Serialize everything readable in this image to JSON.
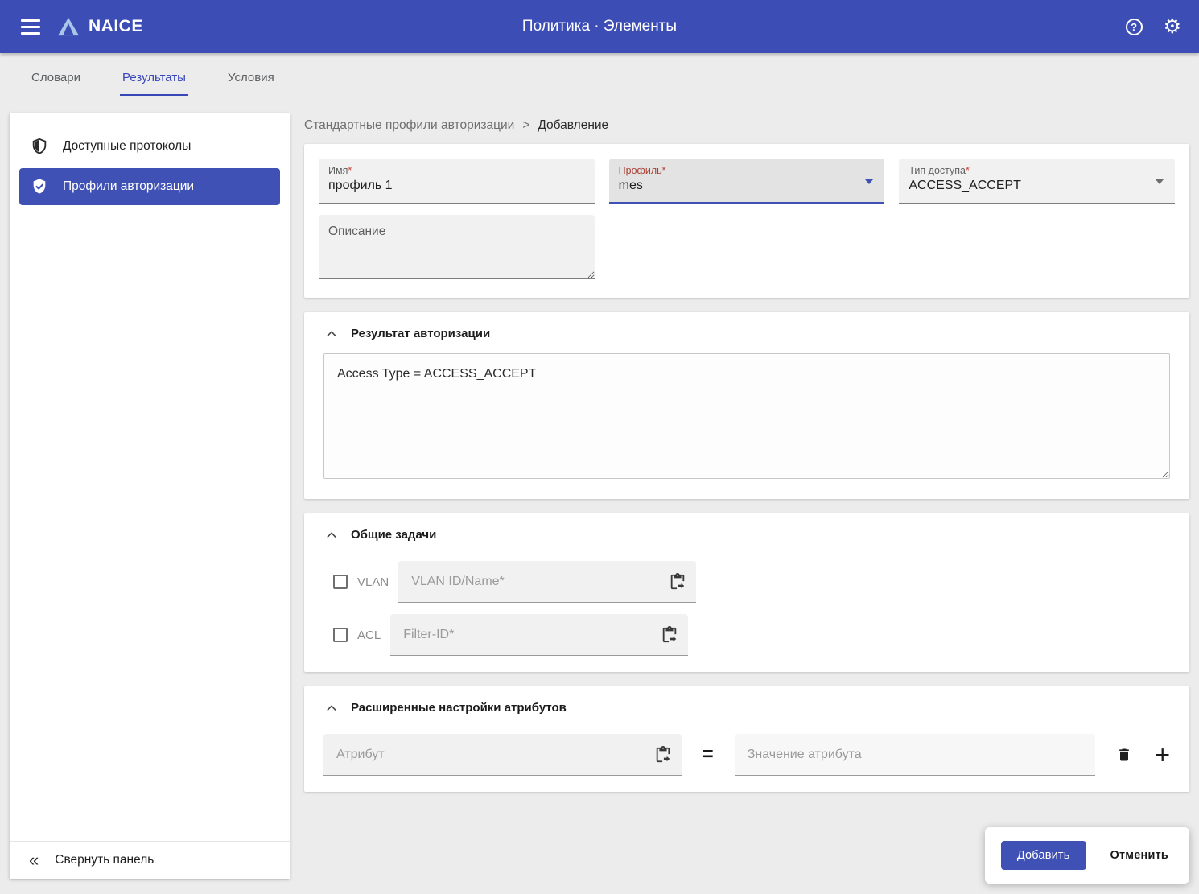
{
  "colors": {
    "primary": "#3f51b5",
    "appbar": "#3c4eb5",
    "required_red": "#d23f31"
  },
  "appbar": {
    "brand": "NAICE",
    "title": "Политика · Элементы",
    "help_glyph": "?",
    "gear_glyph": "⚙"
  },
  "tabs": [
    {
      "label": "Словари",
      "active": false
    },
    {
      "label": "Результаты",
      "active": true
    },
    {
      "label": "Условия",
      "active": false
    }
  ],
  "sidebar": {
    "items": [
      {
        "label": "Доступные протоколы",
        "selected": false
      },
      {
        "label": "Профили авторизации",
        "selected": true
      }
    ],
    "collapse": {
      "icon": "«",
      "label": "Свернуть панель"
    }
  },
  "breadcrumb": {
    "parent": "Стандартные профили авторизации",
    "separator": ">",
    "current": "Добавление"
  },
  "form": {
    "name": {
      "label": "Имя",
      "required": "*",
      "value": "профиль 1"
    },
    "profile": {
      "label": "Профиль",
      "required": "*",
      "value": "mes"
    },
    "access_type": {
      "label": "Тип доступа",
      "required": "*",
      "value": "ACCESS_ACCEPT"
    },
    "description": {
      "placeholder": "Описание"
    }
  },
  "auth_result": {
    "title": "Результат авторизации",
    "value": "Access Type = ACCESS_ACCEPT"
  },
  "common_tasks": {
    "title": "Общие задачи",
    "rows": [
      {
        "label": "VLAN",
        "placeholder": "VLAN ID/Name*"
      },
      {
        "label": "ACL",
        "placeholder": "Filter-ID*"
      }
    ]
  },
  "advanced": {
    "title": "Расширенные настройки атрибутов",
    "attribute_placeholder": "Атрибут",
    "equals": "=",
    "value_placeholder": "Значение атрибута",
    "plus": "+"
  },
  "actions": {
    "add": "Добавить",
    "cancel": "Отменить"
  }
}
